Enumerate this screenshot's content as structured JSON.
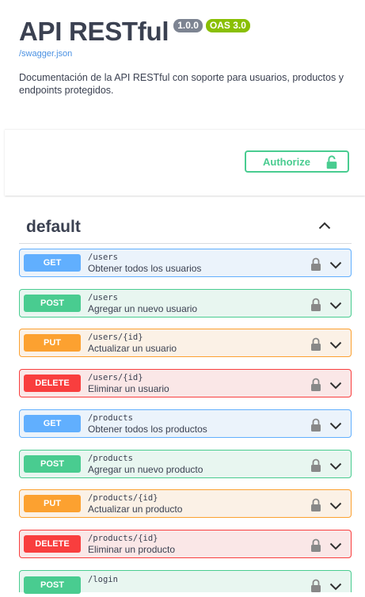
{
  "info": {
    "title": "API RESTful",
    "version": "1.0.0",
    "oas": "OAS 3.0",
    "spec_link": "/swagger.json",
    "description": "Documentación de la API RESTful con soporte para usuarios, productos y endpoints protegidos."
  },
  "authorize": {
    "label": "Authorize"
  },
  "tag": {
    "name": "default"
  },
  "colors": {
    "get": "#61affe",
    "post": "#49cc90",
    "put": "#fca130",
    "delete": "#f93e3e"
  },
  "operations": [
    {
      "method": "GET",
      "path": "/users",
      "summary": "Obtener todos los usuarios"
    },
    {
      "method": "POST",
      "path": "/users",
      "summary": "Agregar un nuevo usuario"
    },
    {
      "method": "PUT",
      "path": "/users/{id}",
      "summary": "Actualizar un usuario"
    },
    {
      "method": "DELETE",
      "path": "/users/{id}",
      "summary": "Eliminar un usuario"
    },
    {
      "method": "GET",
      "path": "/products",
      "summary": "Obtener todos los productos"
    },
    {
      "method": "POST",
      "path": "/products",
      "summary": "Agregar un nuevo producto"
    },
    {
      "method": "PUT",
      "path": "/products/{id}",
      "summary": "Actualizar un producto"
    },
    {
      "method": "DELETE",
      "path": "/products/{id}",
      "summary": "Eliminar un producto"
    },
    {
      "method": "POST",
      "path": "/login",
      "summary": ""
    }
  ]
}
